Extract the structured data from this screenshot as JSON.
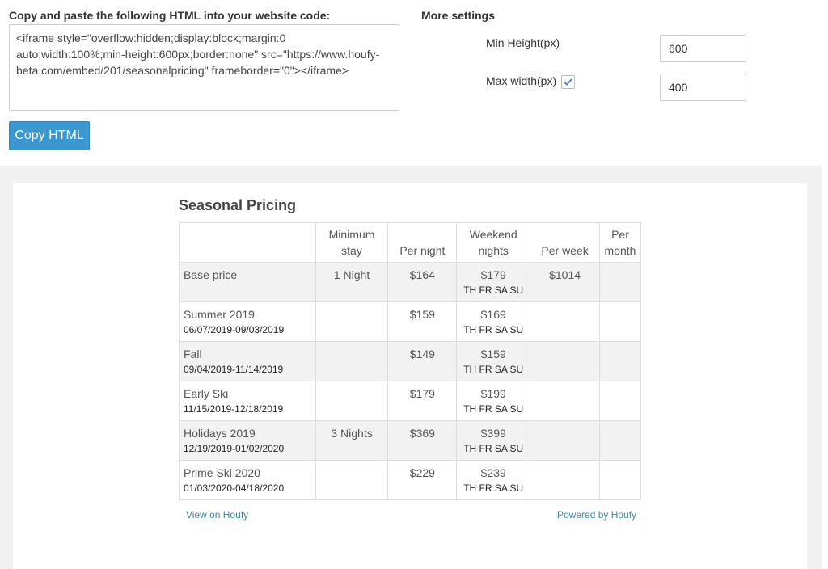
{
  "embed": {
    "label": "Copy and paste the following HTML into your website code:",
    "code": "<iframe style=\"overflow:hidden;display:block;margin:0 auto;width:100%;min-height:600px;border:none\" src=\"https://www.houfy-beta.com/embed/201/seasonalpricing\" frameborder=\"0\"></iframe>",
    "copy_button": "Copy HTML"
  },
  "settings": {
    "title": "More settings",
    "min_height_label": "Min Height(px)",
    "min_height_value": "600",
    "max_width_label": "Max width(px)",
    "max_width_checked": true,
    "max_width_value": "400"
  },
  "preview": {
    "title": "Seasonal Pricing",
    "columns": [
      "",
      "Minimum stay",
      "Per night",
      "Weekend nights",
      "Per week",
      "Per month"
    ],
    "rows": [
      {
        "name": "Base price",
        "dates": "",
        "min_stay": "1 Night",
        "per_night": "$164",
        "weekend": "$179",
        "weekend_days": "TH FR SA SU",
        "per_week": "$1014",
        "per_month": ""
      },
      {
        "name": "Summer 2019",
        "dates": "06/07/2019-09/03/2019",
        "min_stay": "",
        "per_night": "$159",
        "weekend": "$169",
        "weekend_days": "TH FR SA SU",
        "per_week": "",
        "per_month": ""
      },
      {
        "name": "Fall",
        "dates": "09/04/2019-11/14/2019",
        "min_stay": "",
        "per_night": "$149",
        "weekend": "$159",
        "weekend_days": "TH FR SA SU",
        "per_week": "",
        "per_month": ""
      },
      {
        "name": "Early Ski",
        "dates": "11/15/2019-12/18/2019",
        "min_stay": "",
        "per_night": "$179",
        "weekend": "$199",
        "weekend_days": "TH FR SA SU",
        "per_week": "",
        "per_month": ""
      },
      {
        "name": "Holidays 2019",
        "dates": "12/19/2019-01/02/2020",
        "min_stay": "3 Nights",
        "per_night": "$369",
        "weekend": "$399",
        "weekend_days": "TH FR SA SU",
        "per_week": "",
        "per_month": ""
      },
      {
        "name": "Prime Ski 2020",
        "dates": "01/03/2020-04/18/2020",
        "min_stay": "",
        "per_night": "$229",
        "weekend": "$239",
        "weekend_days": "TH FR SA SU",
        "per_week": "",
        "per_month": ""
      }
    ],
    "view_link": "View on Houfy",
    "powered_link": "Powered by Houfy"
  },
  "colors": {
    "accent_button": "#3a97d0",
    "link": "#3a8a9a",
    "preview_background": "#f1f1f1"
  },
  "icons": {
    "checkbox": "checkmark-icon"
  }
}
